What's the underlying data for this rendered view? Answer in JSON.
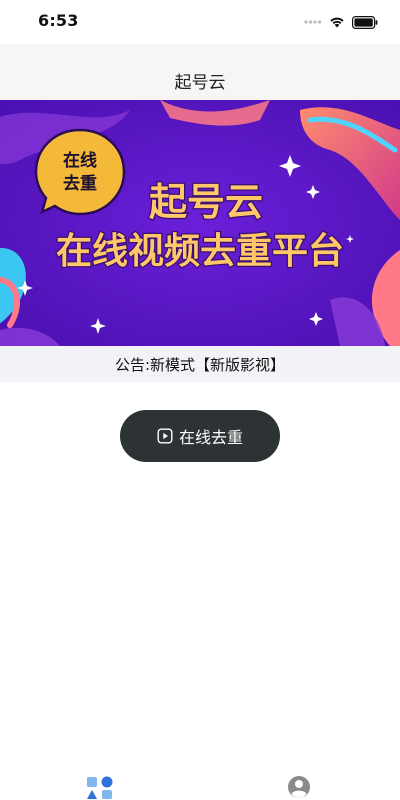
{
  "status_bar": {
    "time": "6:53",
    "icons": [
      "signal-icon",
      "wifi-icon",
      "battery-icon"
    ]
  },
  "nav": {
    "title": "起号云"
  },
  "banner": {
    "badge_line1": "在线",
    "badge_line2": "去重",
    "headline": "起号云",
    "subheadline": "在线视频去重平台",
    "colors": {
      "background": "#5b16c9",
      "badge": "#f5b93a",
      "text": "#ffc66a",
      "accent": "#ff6f7a"
    }
  },
  "notice": {
    "text": "公告:新模式【新版影视】"
  },
  "main": {
    "dedupe_button_label": "在线去重",
    "dedupe_button_icon": "play-circle-icon",
    "button_color": "#2d3335"
  },
  "tabs": [
    {
      "icon": "home-grid-icon"
    },
    {
      "icon": "profile-icon"
    }
  ]
}
